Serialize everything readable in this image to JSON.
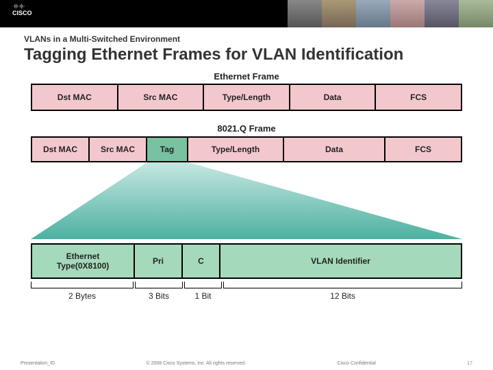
{
  "brand": "CISCO",
  "pre_title": "VLANs in a Multi-Switched Environment",
  "main_title": "Tagging Ethernet Frames for VLAN Identification",
  "ethernet": {
    "label": "Ethernet Frame",
    "cells": {
      "dst": "Dst MAC",
      "src": "Src MAC",
      "tl": "Type/Length",
      "data": "Data",
      "fcs": "FCS"
    }
  },
  "dot1q": {
    "label": "8021.Q Frame",
    "cells": {
      "dst": "Dst MAC",
      "src": "Src MAC",
      "tag": "Tag",
      "tl": "Type/Length",
      "data": "Data",
      "fcs": "FCS"
    }
  },
  "tag_detail": {
    "type_line1": "Ethernet",
    "type_line2": "Type(0X8100)",
    "pri": "Pri",
    "c": "C",
    "vid": "VLAN Identifier"
  },
  "sizes": {
    "bytes2": "2 Bytes",
    "bits3": "3 Bits",
    "bit1": "1 Bit",
    "bits12": "12 Bits"
  },
  "footer": {
    "left": "Presentation_ID",
    "center": "© 2008 Cisco Systems, Inc. All rights reserved.",
    "right": "Cisco Confidential",
    "page": "17"
  }
}
